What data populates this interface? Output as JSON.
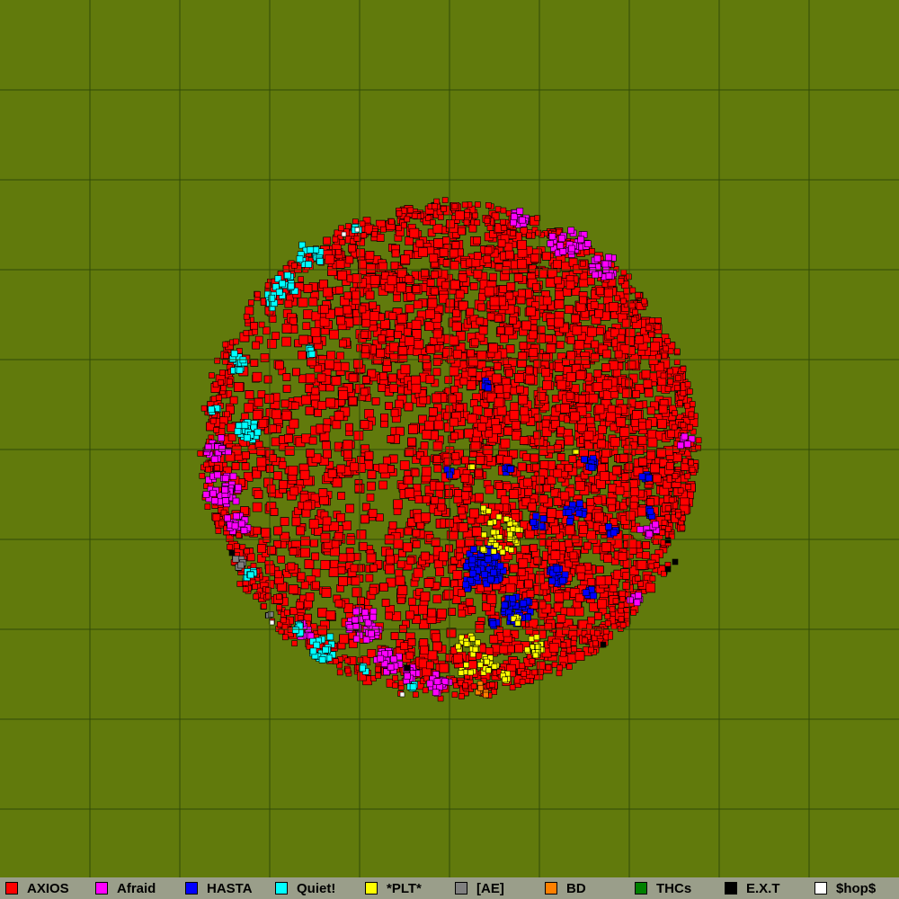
{
  "map": {
    "background_color": "#617a0c",
    "grid_color": "#2f4a08",
    "cell_outline_color": "#000000",
    "grid_cells_per_side": 10
  },
  "legend": {
    "items": [
      {
        "name": "AXIOS",
        "color": "#ff0000"
      },
      {
        "name": "Afraid",
        "color": "#ff00ff"
      },
      {
        "name": "HASTA",
        "color": "#0000ff"
      },
      {
        "name": "Quiet!",
        "color": "#00ffff"
      },
      {
        "name": "*PLT*",
        "color": "#ffff00"
      },
      {
        "name": "[AE]",
        "color": "#808080"
      },
      {
        "name": "BD",
        "color": "#ff8000"
      },
      {
        "name": "THCs",
        "color": "#008000"
      },
      {
        "name": "E.X.T",
        "color": "#000000"
      },
      {
        "name": "$hop$",
        "color": "#ffffff"
      }
    ]
  }
}
